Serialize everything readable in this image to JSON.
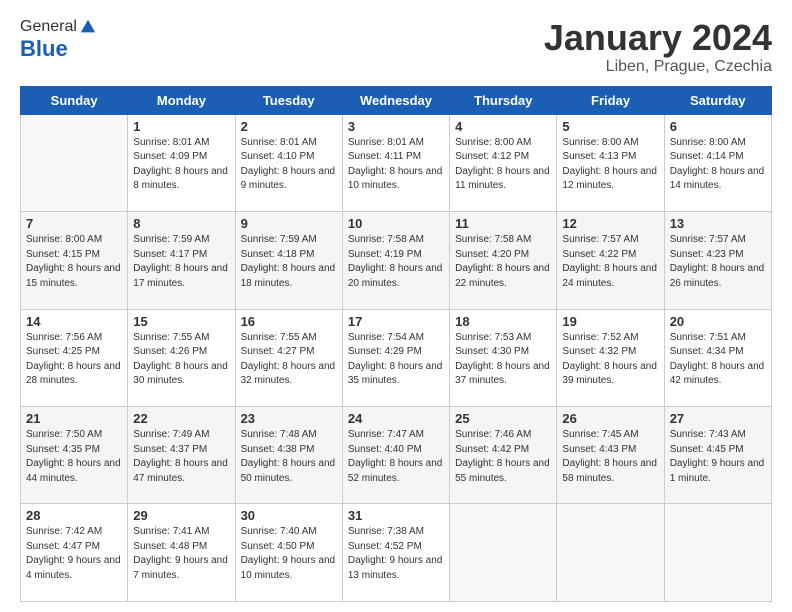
{
  "header": {
    "logo_general": "General",
    "logo_blue": "Blue",
    "month_title": "January 2024",
    "location": "Liben, Prague, Czechia"
  },
  "weekdays": [
    "Sunday",
    "Monday",
    "Tuesday",
    "Wednesday",
    "Thursday",
    "Friday",
    "Saturday"
  ],
  "weeks": [
    [
      {
        "day": "",
        "sunrise": "",
        "sunset": "",
        "daylight": ""
      },
      {
        "day": "1",
        "sunrise": "Sunrise: 8:01 AM",
        "sunset": "Sunset: 4:09 PM",
        "daylight": "Daylight: 8 hours and 8 minutes."
      },
      {
        "day": "2",
        "sunrise": "Sunrise: 8:01 AM",
        "sunset": "Sunset: 4:10 PM",
        "daylight": "Daylight: 8 hours and 9 minutes."
      },
      {
        "day": "3",
        "sunrise": "Sunrise: 8:01 AM",
        "sunset": "Sunset: 4:11 PM",
        "daylight": "Daylight: 8 hours and 10 minutes."
      },
      {
        "day": "4",
        "sunrise": "Sunrise: 8:00 AM",
        "sunset": "Sunset: 4:12 PM",
        "daylight": "Daylight: 8 hours and 11 minutes."
      },
      {
        "day": "5",
        "sunrise": "Sunrise: 8:00 AM",
        "sunset": "Sunset: 4:13 PM",
        "daylight": "Daylight: 8 hours and 12 minutes."
      },
      {
        "day": "6",
        "sunrise": "Sunrise: 8:00 AM",
        "sunset": "Sunset: 4:14 PM",
        "daylight": "Daylight: 8 hours and 14 minutes."
      }
    ],
    [
      {
        "day": "7",
        "sunrise": "Sunrise: 8:00 AM",
        "sunset": "Sunset: 4:15 PM",
        "daylight": "Daylight: 8 hours and 15 minutes."
      },
      {
        "day": "8",
        "sunrise": "Sunrise: 7:59 AM",
        "sunset": "Sunset: 4:17 PM",
        "daylight": "Daylight: 8 hours and 17 minutes."
      },
      {
        "day": "9",
        "sunrise": "Sunrise: 7:59 AM",
        "sunset": "Sunset: 4:18 PM",
        "daylight": "Daylight: 8 hours and 18 minutes."
      },
      {
        "day": "10",
        "sunrise": "Sunrise: 7:58 AM",
        "sunset": "Sunset: 4:19 PM",
        "daylight": "Daylight: 8 hours and 20 minutes."
      },
      {
        "day": "11",
        "sunrise": "Sunrise: 7:58 AM",
        "sunset": "Sunset: 4:20 PM",
        "daylight": "Daylight: 8 hours and 22 minutes."
      },
      {
        "day": "12",
        "sunrise": "Sunrise: 7:57 AM",
        "sunset": "Sunset: 4:22 PM",
        "daylight": "Daylight: 8 hours and 24 minutes."
      },
      {
        "day": "13",
        "sunrise": "Sunrise: 7:57 AM",
        "sunset": "Sunset: 4:23 PM",
        "daylight": "Daylight: 8 hours and 26 minutes."
      }
    ],
    [
      {
        "day": "14",
        "sunrise": "Sunrise: 7:56 AM",
        "sunset": "Sunset: 4:25 PM",
        "daylight": "Daylight: 8 hours and 28 minutes."
      },
      {
        "day": "15",
        "sunrise": "Sunrise: 7:55 AM",
        "sunset": "Sunset: 4:26 PM",
        "daylight": "Daylight: 8 hours and 30 minutes."
      },
      {
        "day": "16",
        "sunrise": "Sunrise: 7:55 AM",
        "sunset": "Sunset: 4:27 PM",
        "daylight": "Daylight: 8 hours and 32 minutes."
      },
      {
        "day": "17",
        "sunrise": "Sunrise: 7:54 AM",
        "sunset": "Sunset: 4:29 PM",
        "daylight": "Daylight: 8 hours and 35 minutes."
      },
      {
        "day": "18",
        "sunrise": "Sunrise: 7:53 AM",
        "sunset": "Sunset: 4:30 PM",
        "daylight": "Daylight: 8 hours and 37 minutes."
      },
      {
        "day": "19",
        "sunrise": "Sunrise: 7:52 AM",
        "sunset": "Sunset: 4:32 PM",
        "daylight": "Daylight: 8 hours and 39 minutes."
      },
      {
        "day": "20",
        "sunrise": "Sunrise: 7:51 AM",
        "sunset": "Sunset: 4:34 PM",
        "daylight": "Daylight: 8 hours and 42 minutes."
      }
    ],
    [
      {
        "day": "21",
        "sunrise": "Sunrise: 7:50 AM",
        "sunset": "Sunset: 4:35 PM",
        "daylight": "Daylight: 8 hours and 44 minutes."
      },
      {
        "day": "22",
        "sunrise": "Sunrise: 7:49 AM",
        "sunset": "Sunset: 4:37 PM",
        "daylight": "Daylight: 8 hours and 47 minutes."
      },
      {
        "day": "23",
        "sunrise": "Sunrise: 7:48 AM",
        "sunset": "Sunset: 4:38 PM",
        "daylight": "Daylight: 8 hours and 50 minutes."
      },
      {
        "day": "24",
        "sunrise": "Sunrise: 7:47 AM",
        "sunset": "Sunset: 4:40 PM",
        "daylight": "Daylight: 8 hours and 52 minutes."
      },
      {
        "day": "25",
        "sunrise": "Sunrise: 7:46 AM",
        "sunset": "Sunset: 4:42 PM",
        "daylight": "Daylight: 8 hours and 55 minutes."
      },
      {
        "day": "26",
        "sunrise": "Sunrise: 7:45 AM",
        "sunset": "Sunset: 4:43 PM",
        "daylight": "Daylight: 8 hours and 58 minutes."
      },
      {
        "day": "27",
        "sunrise": "Sunrise: 7:43 AM",
        "sunset": "Sunset: 4:45 PM",
        "daylight": "Daylight: 9 hours and 1 minute."
      }
    ],
    [
      {
        "day": "28",
        "sunrise": "Sunrise: 7:42 AM",
        "sunset": "Sunset: 4:47 PM",
        "daylight": "Daylight: 9 hours and 4 minutes."
      },
      {
        "day": "29",
        "sunrise": "Sunrise: 7:41 AM",
        "sunset": "Sunset: 4:48 PM",
        "daylight": "Daylight: 9 hours and 7 minutes."
      },
      {
        "day": "30",
        "sunrise": "Sunrise: 7:40 AM",
        "sunset": "Sunset: 4:50 PM",
        "daylight": "Daylight: 9 hours and 10 minutes."
      },
      {
        "day": "31",
        "sunrise": "Sunrise: 7:38 AM",
        "sunset": "Sunset: 4:52 PM",
        "daylight": "Daylight: 9 hours and 13 minutes."
      },
      {
        "day": "",
        "sunrise": "",
        "sunset": "",
        "daylight": ""
      },
      {
        "day": "",
        "sunrise": "",
        "sunset": "",
        "daylight": ""
      },
      {
        "day": "",
        "sunrise": "",
        "sunset": "",
        "daylight": ""
      }
    ]
  ]
}
